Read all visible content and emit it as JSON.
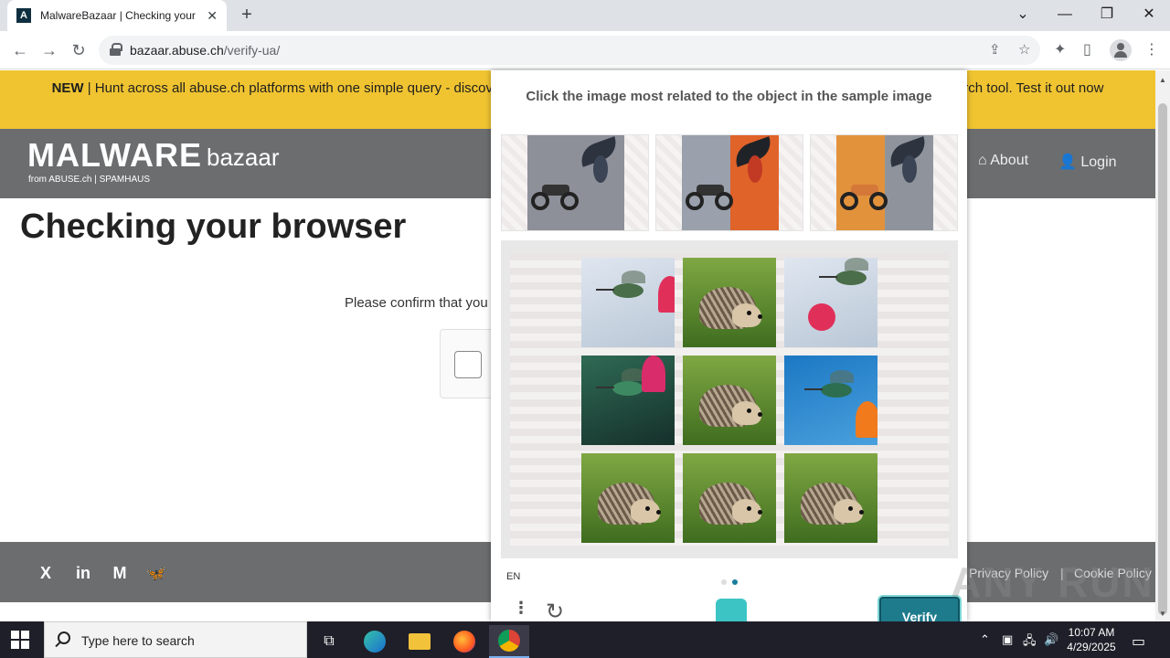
{
  "browser": {
    "tab_title": "MalwareBazaar | Checking your browser",
    "tab_favicon_letter": "A",
    "url_host": "bazaar.abuse.ch",
    "url_path": "/verify-ua/",
    "new_tab_symbol": "+",
    "close_symbol": "✕",
    "window_controls": [
      "⌄",
      "—",
      "❐",
      "✕"
    ]
  },
  "banner": {
    "label": "NEW",
    "text": " | Hunt across all abuse.ch platforms with one simple query - discover more about the abuse.ch threat intelligence platform from a centralized search tool. Test it out now"
  },
  "header": {
    "logo_main": "MALWARE",
    "logo_sub": "bazaar",
    "logo_from": "from ABUSE.ch  |  SPAMHAUS",
    "nav": {
      "about": "About",
      "login": "Login"
    }
  },
  "main": {
    "title": "Checking your browser",
    "confirm_text": "Please confirm that you are human"
  },
  "footer": {
    "social": [
      "X",
      "in",
      "M",
      "🦋"
    ],
    "privacy": "Privacy Policy",
    "separator": "|",
    "cookie": "Cookie Policy"
  },
  "captcha": {
    "prompt": "Click the image most related to the object in the sample image",
    "lang": "EN",
    "menu_symbol": "⋮",
    "refresh_symbol": "↻",
    "verify_label": "Verify",
    "samples": [
      "sample-1",
      "sample-2",
      "sample-3"
    ],
    "tiles": [
      {
        "subject": "hummingbird"
      },
      {
        "subject": "hedgehog"
      },
      {
        "subject": "hummingbird"
      },
      {
        "subject": "hummingbird"
      },
      {
        "subject": "hedgehog"
      },
      {
        "subject": "hummingbird"
      },
      {
        "subject": "hedgehog"
      },
      {
        "subject": "hedgehog"
      },
      {
        "subject": "hedgehog"
      }
    ],
    "active_page": 2,
    "page_count": 2
  },
  "watermark": "ANY RUN",
  "taskbar": {
    "search_placeholder": "Type here to search",
    "time": "10:07 AM",
    "date": "4/29/2025"
  },
  "colors": {
    "banner": "#f0c431",
    "header": "#6b6d6f",
    "verify": "#1e7b8c"
  }
}
